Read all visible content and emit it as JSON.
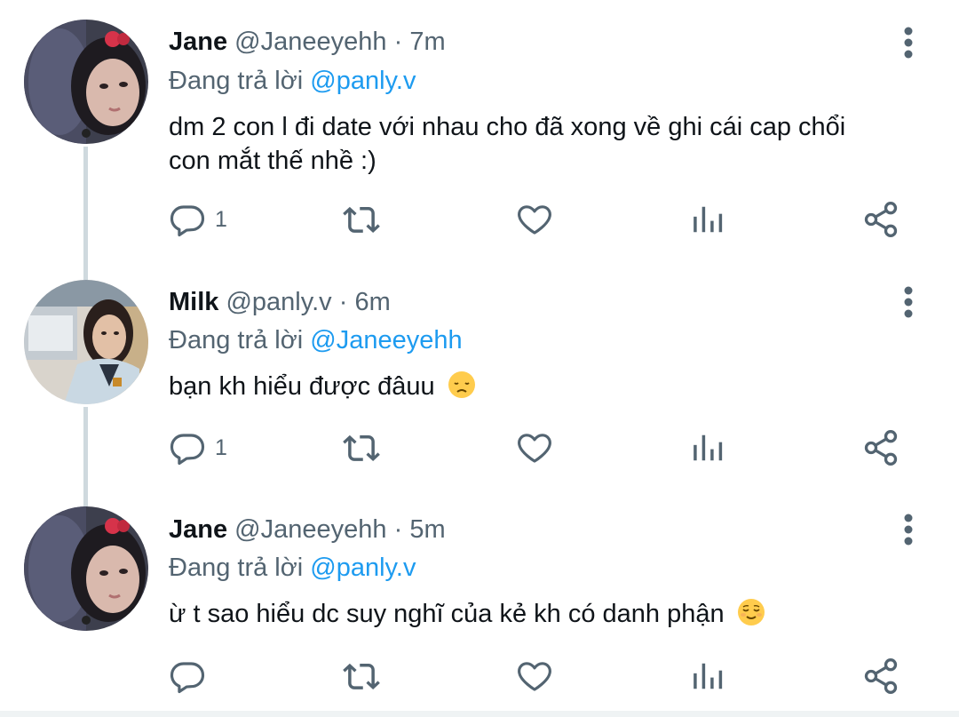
{
  "tweets": [
    {
      "name": "Jane",
      "handle": "@Janeeyehh",
      "separator": "·",
      "time": "7m",
      "replying_prefix": "Đang trả lời",
      "replying_to": "@panly.v",
      "text_line1": "dm 2 con l đi date với nhau cho đã xong về ghi cái cap chổi",
      "text_line2": "con mắt thế nhề :)",
      "reply_count": "1",
      "avatar_icon": "avatar-photo-jane"
    },
    {
      "name": "Milk",
      "handle": "@panly.v",
      "separator": "·",
      "time": "6m",
      "replying_prefix": "Đang trả lời",
      "replying_to": "@Janeeyehh",
      "text_line1": "bạn kh hiểu được đâuu",
      "emoji": "disappointed-face-emoji",
      "reply_count": "1",
      "avatar_icon": "avatar-photo-milk"
    },
    {
      "name": "Jane",
      "handle": "@Janeeyehh",
      "separator": "·",
      "time": "5m",
      "replying_prefix": "Đang trả lời",
      "replying_to": "@panly.v",
      "text_line1": "ừ t sao hiểu dc suy nghĩ của kẻ kh có danh phận",
      "emoji": "relieved-face-emoji",
      "reply_count": "",
      "avatar_icon": "avatar-photo-jane"
    }
  ],
  "colors": {
    "accent": "#1d9bf0",
    "secondary_text": "#536471",
    "primary_text": "#0f1419",
    "thread_line": "#cfd9de"
  },
  "icons": [
    "reply-icon",
    "retweet-icon",
    "like-icon",
    "views-icon",
    "share-icon",
    "more-icon"
  ]
}
